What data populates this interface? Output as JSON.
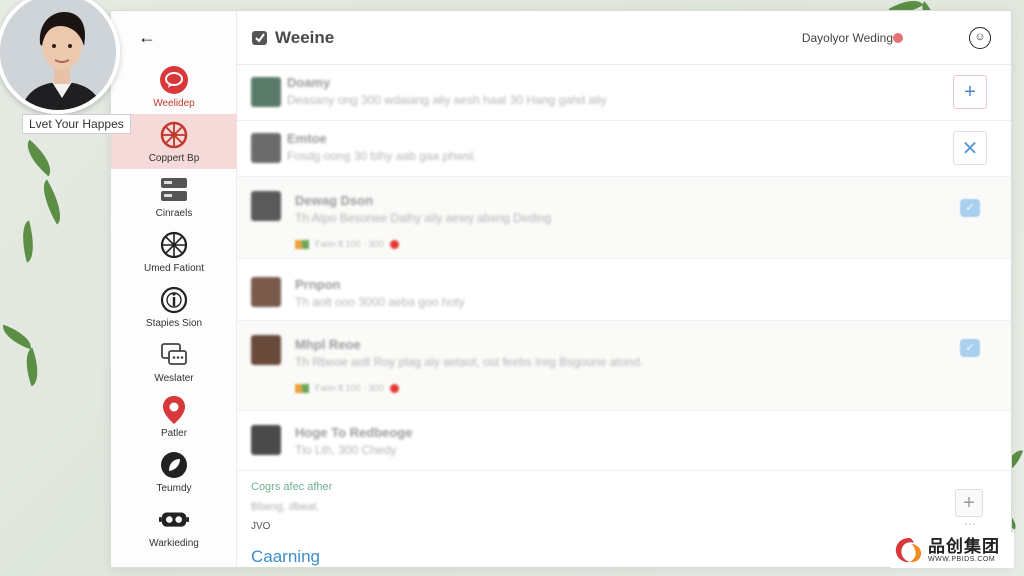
{
  "profile": {
    "tagline": "Lvet Your Happes"
  },
  "sidebar": {
    "items": [
      {
        "label": "Weelidep",
        "icon": "chat-bubble-icon"
      },
      {
        "label": "Coppert Bp",
        "icon": "compass-wheel-icon"
      },
      {
        "label": "Cinraels",
        "icon": "server-stack-icon"
      },
      {
        "label": "Umed Fationt",
        "icon": "aperture-icon"
      },
      {
        "label": "Stapies Sion",
        "icon": "info-circle-icon"
      },
      {
        "label": "Weslater",
        "icon": "chat-windows-icon"
      },
      {
        "label": "Patler",
        "icon": "map-pin-icon"
      },
      {
        "label": "Teumdy",
        "icon": "leaf-circle-icon"
      },
      {
        "label": "Warkieding",
        "icon": "vr-headset-icon"
      }
    ]
  },
  "header": {
    "title": "Weeine",
    "status": "Dayolyor Weding",
    "profile_icon": "profile-icon"
  },
  "list": {
    "rows": [
      {
        "title": "Doamy",
        "desc": "Deasany ong 300 wdaiang aliy aesh haat 30 Hang gahd aliy"
      },
      {
        "title": "Emtoe",
        "desc": "Fosdg oong 30 blhy aab gaa phwsl."
      },
      {
        "title": "Dewag Dson",
        "desc": "Th Atpo Besonee Dalhy aily aewy abxng Deding",
        "meta": "Faon 8 100 · 300"
      },
      {
        "title": "Prnpon",
        "desc": "Th aolt ooo 3000 aeba goo hoty"
      },
      {
        "title": "Mhpl Reoe",
        "desc": "Th Rbeoe aolt Roy plag aiy aetaot, ost feebs Ireg Bsgoone atond.",
        "meta": "Faon 8 100 · 300"
      },
      {
        "title": "Hoge To Redbeoge",
        "desc": "Tlo Lth, 300 Chedy"
      }
    ]
  },
  "footer": {
    "section_title": "Cogrs afec afher",
    "section_sub": "Bbeng, dbeat.",
    "small_label": "JVO",
    "link": "Caarning"
  },
  "brand": {
    "name": "品创集团",
    "url": "WWW.PBIDS.COM"
  },
  "colors": {
    "accent_red": "#d9383a",
    "active_bg": "#f6dada",
    "link_blue": "#3b8fc8",
    "green_text": "#6fb18f"
  }
}
